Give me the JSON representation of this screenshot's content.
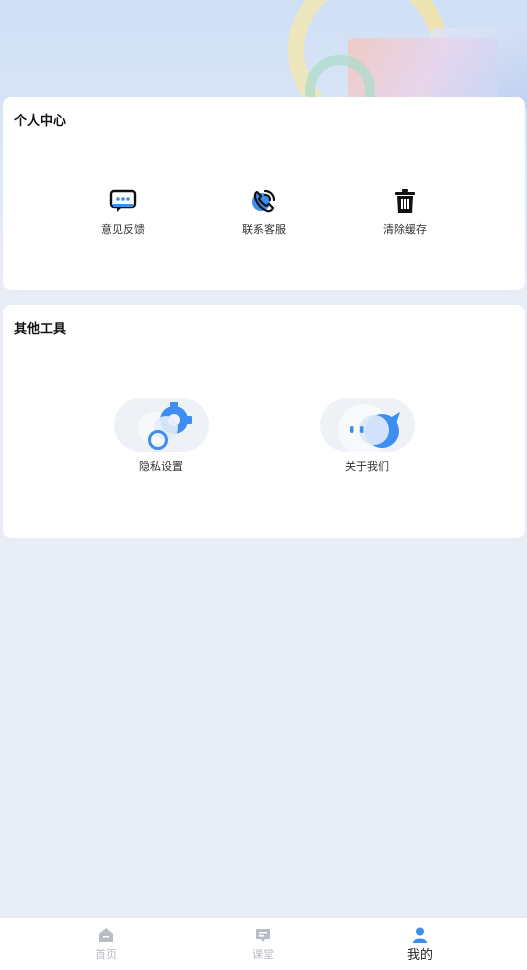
{
  "colors": {
    "accent": "#3d8ef0",
    "page_bg": "#e9edf5",
    "tab_inactive": "#b8bcc4"
  },
  "personal": {
    "title": "个人中心",
    "items": [
      {
        "label": "意见反馈",
        "icon": "feedback-message-icon"
      },
      {
        "label": "联系客服",
        "icon": "phone-call-icon"
      },
      {
        "label": "清除缓存",
        "icon": "trash-icon"
      }
    ]
  },
  "tools": {
    "title": "其他工具",
    "items": [
      {
        "label": "隐私设置",
        "icon": "privacy-gear-icon"
      },
      {
        "label": "关于我们",
        "icon": "about-chat-bubble-icon"
      }
    ]
  },
  "tabbar": {
    "tabs": [
      {
        "label": "首页",
        "icon": "home-icon",
        "active": false
      },
      {
        "label": "课堂",
        "icon": "classroom-icon",
        "active": false
      },
      {
        "label": "我的",
        "icon": "profile-icon",
        "active": true
      }
    ]
  }
}
